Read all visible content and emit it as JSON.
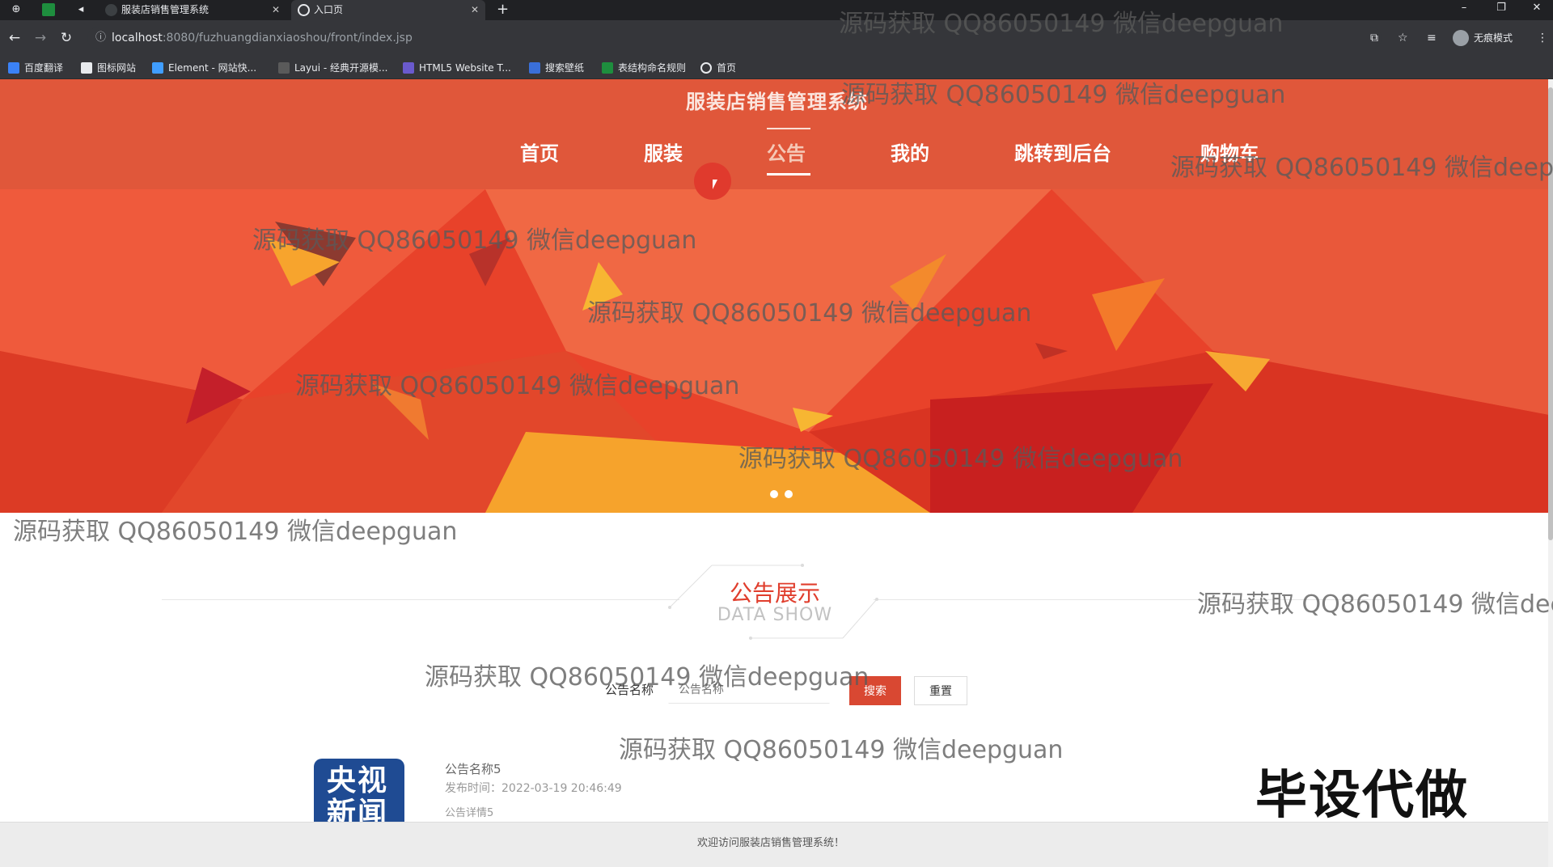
{
  "browser": {
    "tabs": [
      {
        "title": "服装店销售管理系统"
      },
      {
        "title": "入口页"
      }
    ],
    "url_host": "localhost",
    "url_path": ":8080/fuzhuangdianxiaoshou/front/index.jsp",
    "incognito_label": "无痕模式",
    "bookmarks": [
      "百度翻译",
      "图标网站",
      "Element - 网站快...",
      "Layui - 经典开源模...",
      "HTML5 Website T...",
      "搜索壁纸",
      "表结构命名规则",
      "首页"
    ]
  },
  "site": {
    "title": "服装店销售管理系统",
    "nav": [
      "首页",
      "服装",
      "公告",
      "我的",
      "跳转到后台",
      "购物车"
    ],
    "active_nav": "公告"
  },
  "section": {
    "title": "公告展示",
    "subtitle": "DATA SHOW"
  },
  "search": {
    "label": "公告名称",
    "placeholder": "公告名称",
    "search_button": "搜索",
    "reset_button": "重置"
  },
  "notice": {
    "thumb_text": "央视新闻",
    "name": "公告名称5",
    "publish_time": "发布时间：2022-03-19 20:46:49",
    "detail": "公告详情5"
  },
  "footer": {
    "text": "欢迎访问服装店销售管理系统！"
  },
  "overlay": {
    "stamp": "毕设代做",
    "watermark": "源码获取 QQ86050149 微信deepguan"
  },
  "colors": {
    "header_bg": "#e0573a",
    "accent": "#d94832",
    "banner_bg": "#e8422a"
  }
}
